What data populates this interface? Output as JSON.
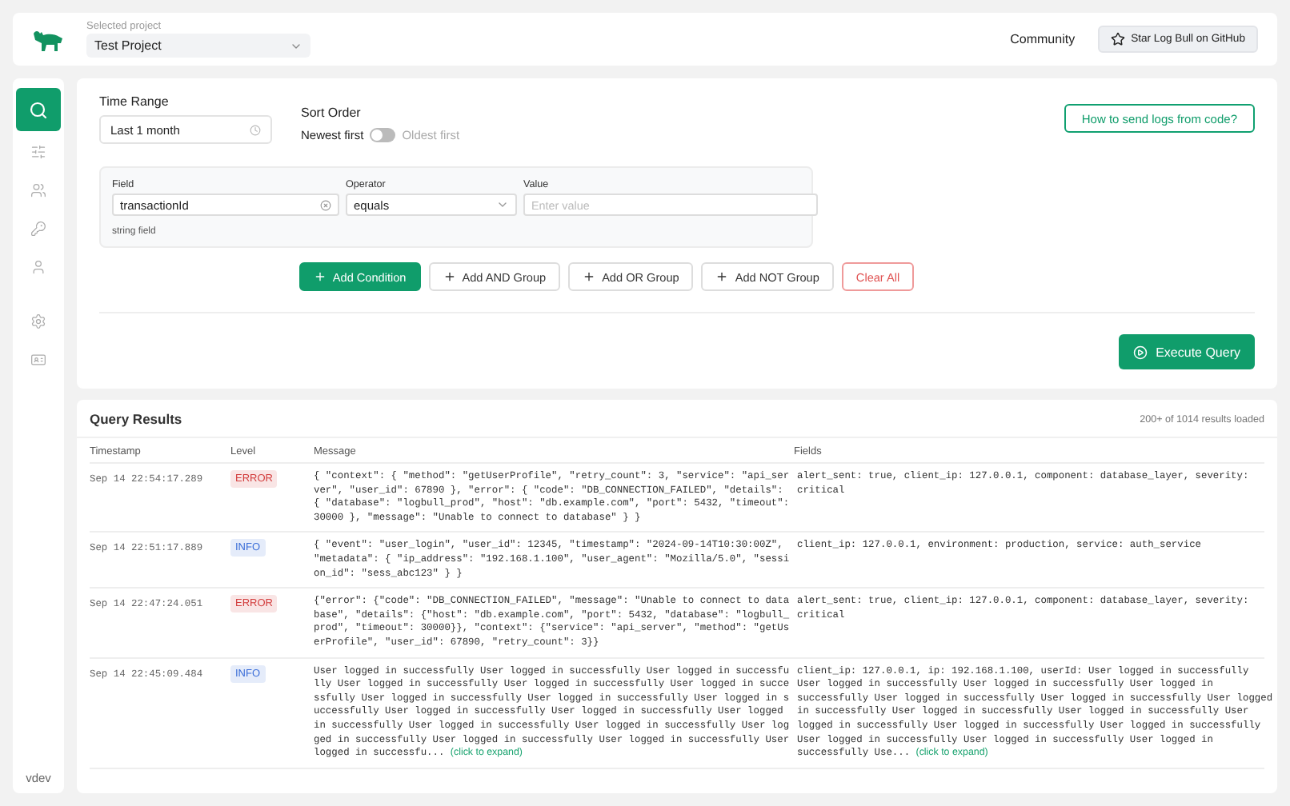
{
  "header": {
    "project_label": "Selected project",
    "project": "Test Project",
    "community": "Community",
    "github_button": "Star Log Bull on GitHub"
  },
  "sidebar": {
    "items": [
      {
        "kind": "search",
        "selected": true
      },
      {
        "kind": "sliders",
        "selected": false
      },
      {
        "kind": "users",
        "selected": false
      },
      {
        "kind": "key",
        "selected": false
      },
      {
        "kind": "user",
        "selected": false
      },
      {
        "kind": "settings",
        "selected": false
      },
      {
        "kind": "card",
        "selected": false
      }
    ],
    "version": "vdev"
  },
  "query": {
    "time_range": {
      "label": "Time Range",
      "value": "Last 1 month"
    },
    "sort_order": {
      "label": "Sort Order",
      "left": "Newest first",
      "right": "Oldest first",
      "on": false
    },
    "help_link": "How to send logs from code?",
    "condition": {
      "field_label": "Field",
      "field_value": "transactionId",
      "operator_label": "Operator",
      "operator_value": "equals",
      "value_label": "Value",
      "value_placeholder": "Enter value",
      "hint": "string field"
    },
    "buttons": [
      {
        "label": "Add Condition",
        "kind": "primary"
      },
      {
        "label": "Add AND Group",
        "kind": "add"
      },
      {
        "label": "Add OR Group",
        "kind": "add"
      },
      {
        "label": "Add NOT Group",
        "kind": "add"
      },
      {
        "label": "Clear All",
        "kind": "danger"
      }
    ],
    "execute": "Execute Query"
  },
  "results": {
    "title": "Query Results",
    "count": "200+ of 1014 results loaded",
    "columns": [
      "Timestamp",
      "Level",
      "Message",
      "Fields"
    ],
    "rows": [
      {
        "timestamp": "Sep 14 22:54:17.289",
        "level": "ERROR",
        "color": "#d23c3c",
        "message": "{ \"context\": { \"method\": \"getUserProfile\", \"retry_count\": 3, \"service\": \"api_server\", \"user_id\": 67890 }, \"error\": { \"code\": \"DB_CONNECTION_FAILED\", \"details\": { \"database\": \"logbull_prod\", \"host\": \"db.example.com\", \"port\": 5432, \"timeout\": 30000 }, \"message\": \"Unable to connect to database\" } }",
        "fields": "alert_sent: true, client_ip: 127.0.0.1, component: database_layer, severity: critical"
      },
      {
        "timestamp": "Sep 14 22:51:17.889",
        "level": "INFO",
        "color": "#3b6ed8",
        "message": "{ \"event\": \"user_login\", \"user_id\": 12345, \"timestamp\": \"2024-09-14T10:30:00Z\", \"metadata\": { \"ip_address\": \"192.168.1.100\", \"user_agent\": \"Mozilla/5.0\", \"session_id\": \"sess_abc123\" } }",
        "fields": "client_ip: 127.0.0.1, environment: production, service: auth_service"
      },
      {
        "timestamp": "Sep 14 22:47:24.051",
        "level": "ERROR",
        "color": "#d23c3c",
        "message": "{\"error\": {\"code\": \"DB_CONNECTION_FAILED\", \"message\": \"Unable to connect to database\", \"details\": {\"host\": \"db.example.com\", \"port\": 5432, \"database\": \"logbull_prod\", \"timeout\": 30000}}, \"context\": {\"service\": \"api_server\", \"method\": \"getUserProfile\", \"user_id\": 67890, \"retry_count\": 3}}",
        "fields": "alert_sent: true, client_ip: 127.0.0.1, component: database_layer, severity: critical"
      },
      {
        "timestamp": "Sep 14 22:45:09.484",
        "level": "INFO",
        "color": "#3b6ed8",
        "message": "User logged in successfully User logged in successfully User logged in successfully User logged in successfully User logged in successfully User logged in successfully User logged in successfully User logged in successfully User logged in successfully User logged in successfully User logged in successfully User logged in successfully User logged in successfully User logged in successfully User logged in successfully User logged in successfully User logged in successfully User logged in successfu...",
        "message_expand": "(click to expand)",
        "fields": "client_ip: 127.0.0.1, ip: 192.168.1.100, userId: User logged in successfully User logged in successfully User logged in successfully User logged in successfully User logged in successfully User logged in successfully User logged in successfully User logged in successfully User logged in successfully User logged in successfully User logged in successfully User logged in successfully User logged in successfully User logged in successfully User logged in successfully Use...",
        "fields_expand": "(click to expand)"
      }
    ]
  }
}
